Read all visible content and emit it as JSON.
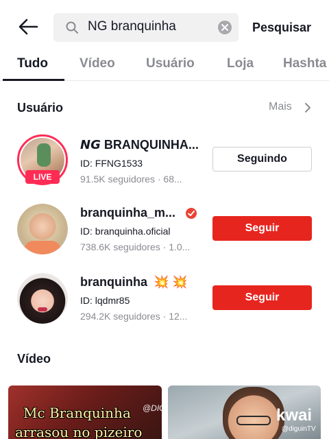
{
  "search": {
    "query": "NG branquinha",
    "submit_label": "Pesquisar"
  },
  "tabs": [
    {
      "label": "Tudo",
      "active": true
    },
    {
      "label": "Vídeo",
      "active": false
    },
    {
      "label": "Usuário",
      "active": false
    },
    {
      "label": "Loja",
      "active": false
    },
    {
      "label": "Hashta",
      "active": false
    }
  ],
  "users_section": {
    "title": "Usuário",
    "more_label": "Mais",
    "users": [
      {
        "name": "𝙉𝙂 BRANQUINHA...",
        "id": "ID: FFNG1533",
        "followers": "91.5K seguidores · 68...",
        "live_label": "LIVE",
        "button_label": "Seguindo",
        "following": true
      },
      {
        "name": "branquinha_m...",
        "id": "ID: branquinha.oficial",
        "followers": "738.6K seguidores · 1.0...",
        "verified": true,
        "button_label": "Seguir",
        "following": false
      },
      {
        "name": "branquinha",
        "emoji": "💥 💥",
        "id": "ID: lqdmr85",
        "followers": "294.2K seguidores · 12...",
        "button_label": "Seguir",
        "following": false
      }
    ]
  },
  "video_section": {
    "title": "Vídeo",
    "videos": [
      {
        "caption_line1": "Mc Branquinha",
        "caption_line2": "arrasou no pizeiro",
        "watermark": "@DIGUINTV"
      },
      {
        "brand": "kwai",
        "handle": "@diguinTV"
      }
    ]
  },
  "colors": {
    "follow_button": "#e7251f",
    "live_badge": "#fe2c55",
    "verified_badge": "#ea4335",
    "muted_text": "#8a8b91"
  },
  "icons": [
    "back-arrow-icon",
    "search-icon",
    "clear-icon",
    "chevron-right-icon",
    "verified-icon"
  ]
}
